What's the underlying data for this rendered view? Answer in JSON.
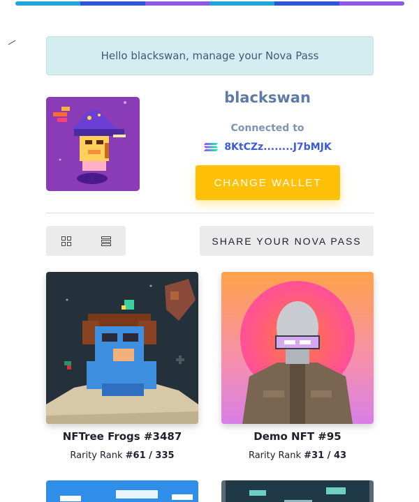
{
  "colors": {
    "accent": "#ffc107",
    "wallet_link": "#3b5bdb",
    "greeting_bg": "#d3edf1",
    "topbar": [
      "#1ea6d6",
      "#2f55d4",
      "#8c5be0",
      "#1ea6d6",
      "#2f55d4",
      "#8c5be0"
    ]
  },
  "greeting": {
    "text": "Hello blackswan, manage your Nova Pass"
  },
  "profile": {
    "username": "blackswan",
    "connected_label": "Connected to",
    "wallet_icon": "solana-icon",
    "wallet_address": "8KtCZz........J7bMJK",
    "change_wallet_label": "CHANGE WALLET"
  },
  "toolbar": {
    "grid_view_icon": "grid-view-icon",
    "list_view_icon": "list-view-icon",
    "share_label": "SHARE YOUR NOVA PASS"
  },
  "nfts": [
    {
      "name": "NFTree Frogs #3487",
      "rank_label": "Rarity Rank",
      "rank": "#61 / 335"
    },
    {
      "name": "Demo NFT #95",
      "rank_label": "Rarity Rank",
      "rank": "#31 / 43"
    },
    {
      "name": "",
      "rank_label": "",
      "rank": ""
    },
    {
      "name": "",
      "rank_label": "",
      "rank": ""
    }
  ]
}
